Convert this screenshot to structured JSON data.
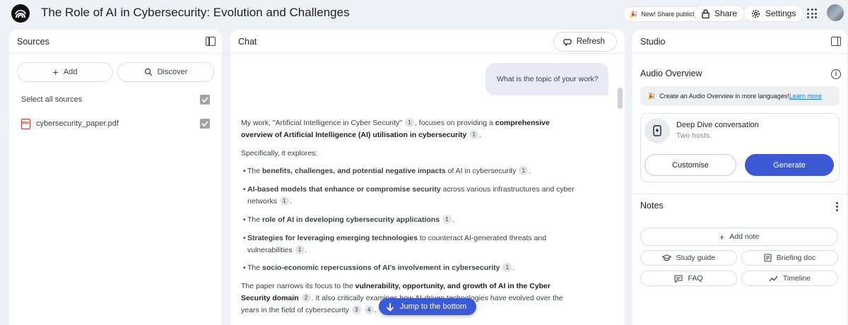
{
  "app": {
    "title": "The Role of AI in Cybersecurity: Evolution and Challenges",
    "share_publicly": "New! Share publicly",
    "share": "Share",
    "settings": "Settings"
  },
  "sources": {
    "header": "Sources",
    "add": "Add",
    "discover": "Discover",
    "select_all": "Select all sources",
    "items": [
      {
        "name": "cybersecurity_paper.pdf",
        "checked": true
      }
    ]
  },
  "chat": {
    "header": "Chat",
    "refresh": "Refresh",
    "user_message": "What is the topic of your work?",
    "jump_to_bottom": "Jump to the bottom",
    "response": {
      "p1_a": "My work, \"Artificial Intelligence in Cyber Security\"",
      "p1_cite1": "1",
      "p1_b": ", focuses on providing a ",
      "p1_bold": "comprehensive overview of Artificial Intelligence (AI) utilisation in cybersecurity",
      "p1_cite2": "1",
      "p1_end": ".",
      "p2": "Specifically, it explores:",
      "bullets": [
        {
          "pre": "The ",
          "bold": "benefits, challenges, and potential negative impacts",
          "post": " of AI in cybersecurity",
          "cite": "1"
        },
        {
          "pre": "",
          "bold": "AI-based models that enhance or compromise security",
          "post": " across various infrastructures and cyber networks",
          "cite": "1"
        },
        {
          "pre": "The ",
          "bold": "role of AI in developing cybersecurity applications",
          "post": "",
          "cite": "1"
        },
        {
          "pre": "",
          "bold": "Strategies for leveraging emerging technologies",
          "post": " to counteract AI-generated threats and vulnerabilities",
          "cite": "1"
        },
        {
          "pre": "The ",
          "bold": "socio-economic repercussions of AI's involvement in cybersecurity",
          "post": "",
          "cite": "1"
        }
      ],
      "p3_a": "The paper narrows its focus to the ",
      "p3_bold": "vulnerability, opportunity, and growth of AI in the Cyber Security domain",
      "p3_cite1": "2",
      "p3_b": ". It also critically examines how AI-driven technologies have evolved over the years in the field of cybersecurity",
      "p3_cite2": "3",
      "p3_cite3": "4",
      "p3_end": "."
    }
  },
  "studio": {
    "header": "Studio",
    "audio_overview": "Audio Overview",
    "banner_text": "Create an Audio Overview in more languages!",
    "banner_link": "Learn more",
    "deep_dive_title": "Deep Dive conversation",
    "deep_dive_sub": "Two hosts",
    "customise": "Customise",
    "generate": "Generate",
    "notes": "Notes",
    "add_note": "Add note",
    "study_guide": "Study guide",
    "briefing_doc": "Briefing doc",
    "faq": "FAQ",
    "timeline": "Timeline"
  },
  "colors": {
    "accent": "#3c5ad6",
    "background": "#eef1f6",
    "link": "#1a73e8",
    "pdf": "#d93025"
  }
}
